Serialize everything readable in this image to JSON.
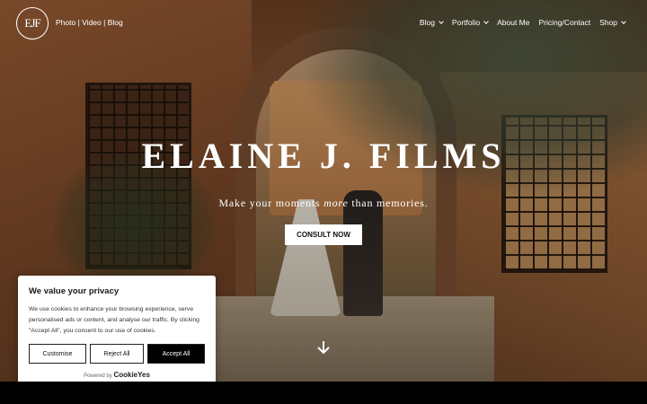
{
  "header": {
    "logo_text": "EJF",
    "tagline": "Photo | Video | Blog",
    "menu": [
      {
        "label": "Blog",
        "has_dropdown": true
      },
      {
        "label": "Portfolio",
        "has_dropdown": true
      },
      {
        "label": "About Me",
        "has_dropdown": false
      },
      {
        "label": "Pricing/Contact",
        "has_dropdown": false
      },
      {
        "label": "Shop",
        "has_dropdown": true
      }
    ]
  },
  "hero": {
    "title": "ELAINE J. FILMS",
    "subtitle_before": "Make your moments ",
    "subtitle_em": "more",
    "subtitle_after": " than memories.",
    "cta_label": "CONSULT NOW",
    "scroll_icon": "arrow-down-icon"
  },
  "cookie_banner": {
    "title": "We value your privacy",
    "body": "We use cookies to enhance your browsing experience, serve personalised ads or content, and analyse our traffic. By clicking \"Accept All\", you consent to our use of cookies.",
    "customise_label": "Customise",
    "reject_label": "Reject All",
    "accept_label": "Accept All",
    "powered_by": "Powered by",
    "brand": "CookieYes"
  },
  "colors": {
    "accent_button_bg": "#ffffff",
    "accept_bg": "#000000",
    "text_light": "#ffffff"
  }
}
